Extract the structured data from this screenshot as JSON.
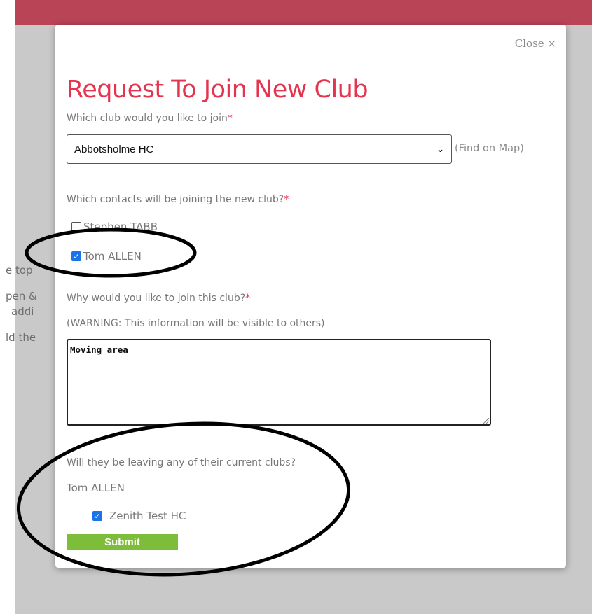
{
  "background": {
    "fragments": [
      "e top",
      "pen &",
      "addi",
      "ld the"
    ]
  },
  "modal": {
    "close_label": "Close ×",
    "title": "Request To Join New Club",
    "club_question": "Which club would you like to join",
    "club_select": {
      "value": "Abbotsholme HC"
    },
    "find_on_map": "(Find on Map)",
    "contacts_question": "Which contacts will be joining the new club?",
    "contacts": [
      {
        "name": "Stephen TABB",
        "checked": false
      },
      {
        "name": "Tom ALLEN",
        "checked": true
      }
    ],
    "reason_question": "Why would you like to join this club?",
    "reason_warning": "(WARNING: This information will be visible to others)",
    "reason_value": "Moving area",
    "leaving_question": "Will they be leaving any of their current clubs?",
    "leaving_contact_name": "Tom ALLEN",
    "leaving_clubs": [
      {
        "name": "Zenith Test HC",
        "checked": true
      }
    ],
    "submit_label": "Submit",
    "required_marker": "*"
  },
  "colors": {
    "accent": "#e5344f",
    "top_bar": "#b94456",
    "submit": "#7dbd3a",
    "checkbox": "#1a73e8"
  }
}
